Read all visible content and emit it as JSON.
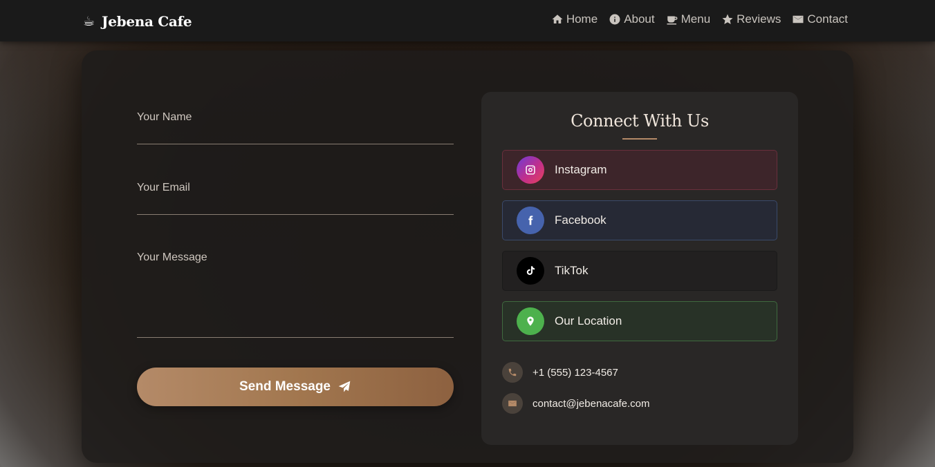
{
  "brand": {
    "icon": "coffee-cup-icon",
    "name": "Jebena Cafe"
  },
  "nav": [
    {
      "label": "Home",
      "icon": "home-icon"
    },
    {
      "label": "About",
      "icon": "info-icon"
    },
    {
      "label": "Menu",
      "icon": "coffee-mug-icon"
    },
    {
      "label": "Reviews",
      "icon": "star-icon"
    },
    {
      "label": "Contact",
      "icon": "envelope-icon"
    }
  ],
  "form": {
    "name_label": "Your Name",
    "email_label": "Your Email",
    "message_label": "Your Message",
    "send_label": "Send Message",
    "send_icon": "paper-plane-icon"
  },
  "connect": {
    "title": "Connect With Us",
    "socials": [
      {
        "label": "Instagram",
        "icon": "instagram-icon"
      },
      {
        "label": "Facebook",
        "icon": "facebook-icon"
      },
      {
        "label": "TikTok",
        "icon": "tiktok-icon"
      },
      {
        "label": "Our Location",
        "icon": "location-pin-icon"
      }
    ],
    "phone": "+1 (555) 123-4567",
    "email": "contact@jebenacafe.com"
  },
  "colors": {
    "accent": "#b48a68",
    "navbar": "#1a1a1a",
    "card": "#1e1c1b",
    "instagram": "#c12f8c",
    "facebook": "#4663ad",
    "tiktok": "#000000",
    "location": "#4db14d"
  }
}
